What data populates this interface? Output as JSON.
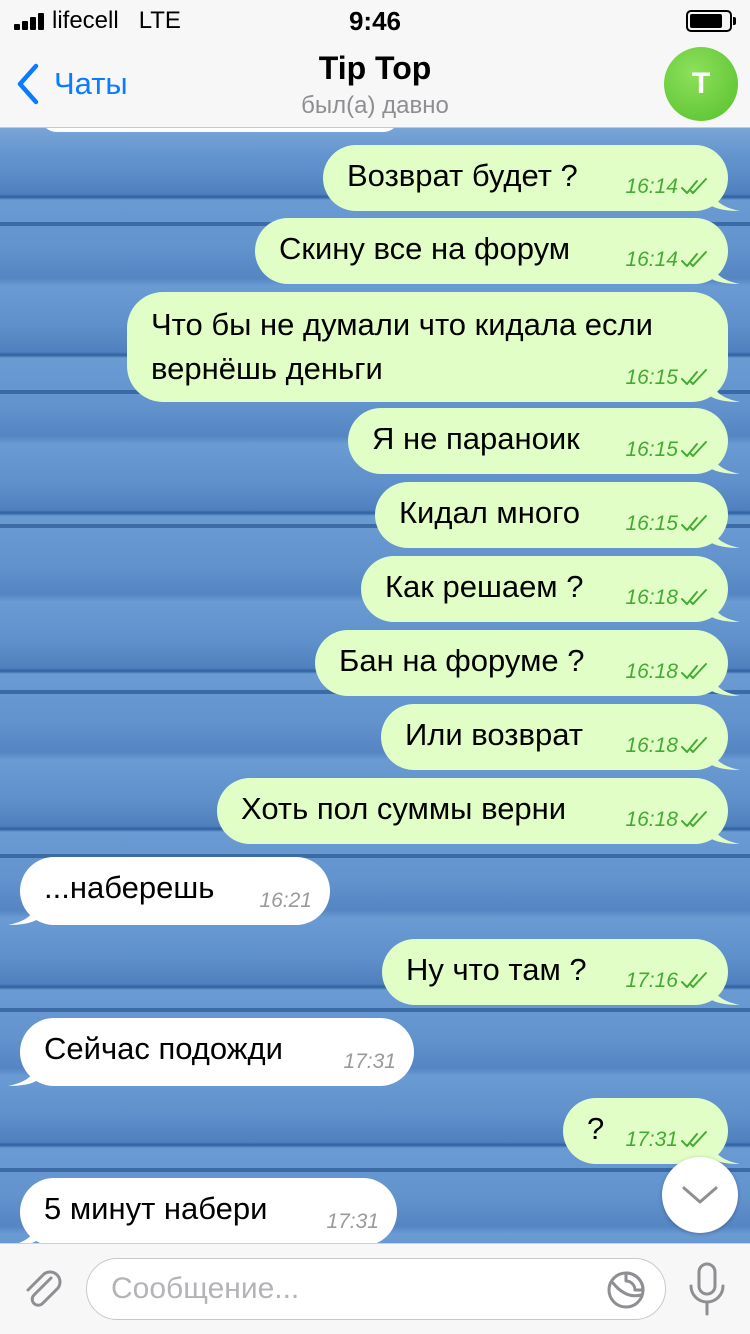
{
  "status_bar": {
    "carrier": "lifecell   LTE",
    "time": "9:46",
    "battery_level": 0.85,
    "signal_bars": 4
  },
  "header": {
    "back_label": "Чаты",
    "title": "Tip Top",
    "subtitle": "был(а) давно",
    "avatar_letter": "T",
    "avatar_color": "#5cc531"
  },
  "colors": {
    "outgoing_bubble": "#e1fec6",
    "incoming_bubble": "#ffffff",
    "outgoing_time": "#43ab33",
    "accent": "#0a7cff"
  },
  "messages": [
    {
      "text": "Возврат будет ?",
      "time": "16:14",
      "direction": "out",
      "read": true
    },
    {
      "text": "Скину все на форум",
      "time": "16:14",
      "direction": "out",
      "read": true
    },
    {
      "text": "Что бы не думали что кидала если вернёшь деньги",
      "time": "16:15",
      "direction": "out",
      "read": true
    },
    {
      "text": "Я не параноик",
      "time": "16:15",
      "direction": "out",
      "read": true
    },
    {
      "text": "Кидал много",
      "time": "16:15",
      "direction": "out",
      "read": true
    },
    {
      "text": "Как решаем ?",
      "time": "16:18",
      "direction": "out",
      "read": true
    },
    {
      "text": "Бан на форуме ?",
      "time": "16:18",
      "direction": "out",
      "read": true
    },
    {
      "text": "Или возврат",
      "time": "16:18",
      "direction": "out",
      "read": true
    },
    {
      "text": "Хоть пол суммы верни",
      "time": "16:18",
      "direction": "out",
      "read": true
    },
    {
      "text": "...наберешь",
      "time": "16:21",
      "direction": "in"
    },
    {
      "text": "Ну что там ?",
      "time": "17:16",
      "direction": "out",
      "read": true
    },
    {
      "text": "Сейчас подожди",
      "time": "17:31",
      "direction": "in"
    },
    {
      "text": "?",
      "time": "17:31",
      "direction": "out",
      "read": true
    },
    {
      "text": "5 минут набери",
      "time": "17:31",
      "direction": "in"
    }
  ],
  "composer": {
    "placeholder": "Сообщение...",
    "value": ""
  },
  "icons": {
    "back": "chevron-left-icon",
    "attach": "paperclip-icon",
    "sticker": "sticker-icon",
    "mic": "microphone-icon",
    "scroll_down": "chevron-down-icon",
    "read_receipt": "double-check-icon"
  }
}
